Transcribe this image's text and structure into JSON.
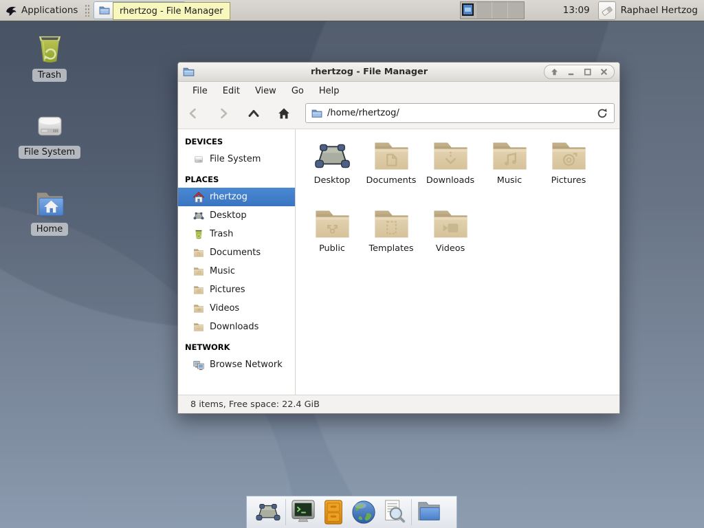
{
  "panel": {
    "applications_label": "Applications",
    "task_button_label": "rhertzog - File Manager",
    "tooltip": "rhertzog - File Manager",
    "clock": "13:09",
    "user_name": "Raphael Hertzog"
  },
  "desktop_icons": {
    "trash": "Trash",
    "file_system": "File System",
    "home": "Home"
  },
  "window": {
    "title": "rhertzog - File Manager",
    "menu": [
      "File",
      "Edit",
      "View",
      "Go",
      "Help"
    ],
    "location": "/home/rhertzog/",
    "sidebar": {
      "devices_header": "DEVICES",
      "places_header": "PLACES",
      "network_header": "NETWORK",
      "devices": [
        {
          "label": "File System"
        }
      ],
      "places": [
        {
          "label": "rhertzog",
          "selected": true
        },
        {
          "label": "Desktop"
        },
        {
          "label": "Trash"
        },
        {
          "label": "Documents"
        },
        {
          "label": "Music"
        },
        {
          "label": "Pictures"
        },
        {
          "label": "Videos"
        },
        {
          "label": "Downloads"
        }
      ],
      "network": [
        {
          "label": "Browse Network"
        }
      ]
    },
    "files": [
      {
        "label": "Desktop",
        "icon": "desktop"
      },
      {
        "label": "Documents",
        "icon": "folder-documents"
      },
      {
        "label": "Downloads",
        "icon": "folder-downloads"
      },
      {
        "label": "Music",
        "icon": "folder-music"
      },
      {
        "label": "Pictures",
        "icon": "folder-pictures"
      },
      {
        "label": "Public",
        "icon": "folder-public"
      },
      {
        "label": "Templates",
        "icon": "folder-templates"
      },
      {
        "label": "Videos",
        "icon": "folder-videos"
      }
    ],
    "status": "8 items, Free space: 22.4 GiB"
  },
  "dock": [
    "show-desktop",
    "terminal",
    "file-cabinet",
    "web-browser",
    "search-files",
    "file-manager"
  ],
  "colors": {
    "selection_blue": "#3f7ecb",
    "tooltip_bg": "#f7f7be",
    "folder_tan": "#dccaa5",
    "desktop_bg_top": "#4d5969",
    "desktop_bg_bottom": "#8595aa"
  }
}
